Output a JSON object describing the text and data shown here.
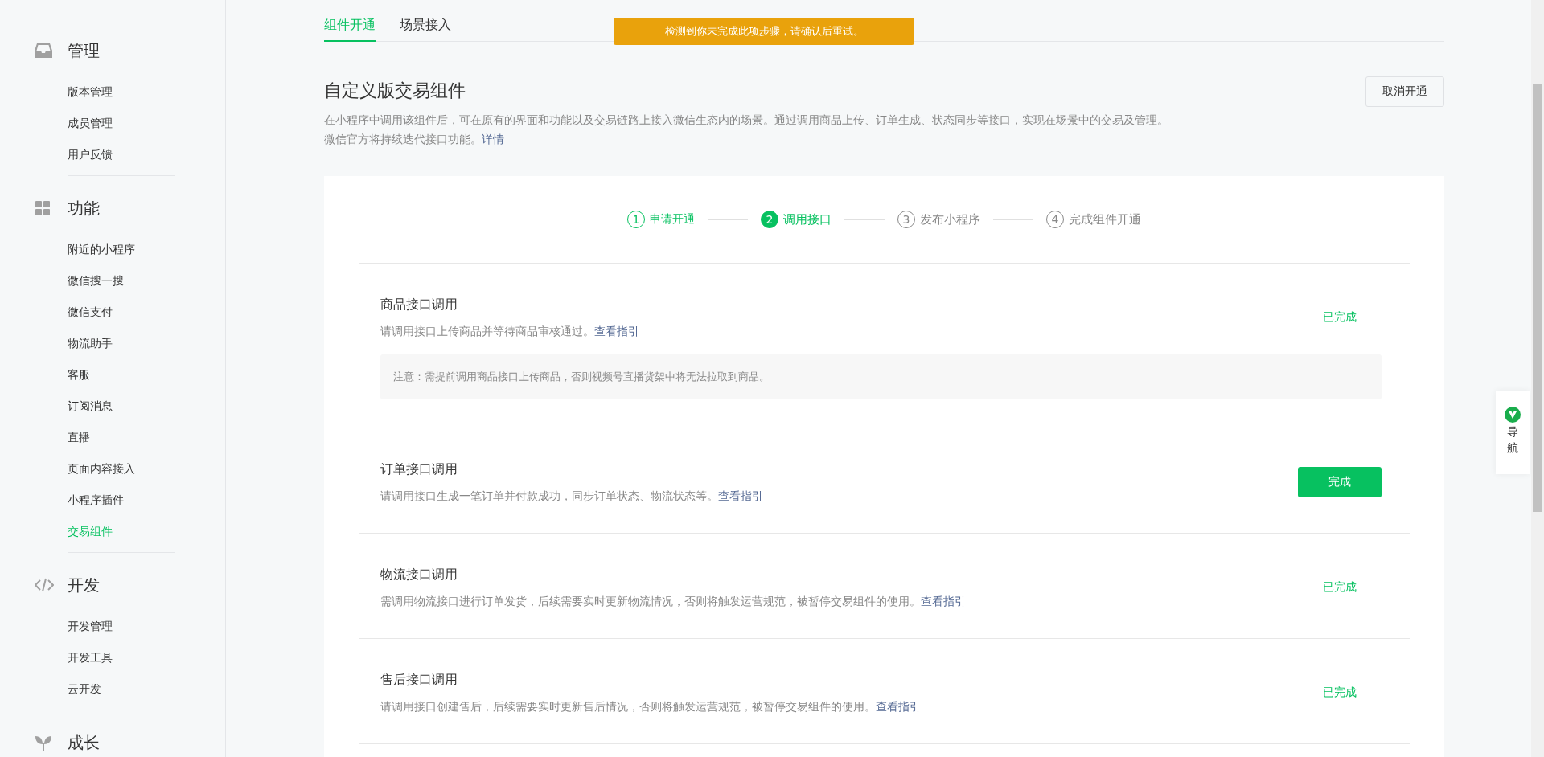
{
  "sidebar": {
    "groups": [
      {
        "title": "管理",
        "items": [
          {
            "label": "版本管理",
            "selected": false
          },
          {
            "label": "成员管理",
            "selected": false
          },
          {
            "label": "用户反馈",
            "selected": false
          }
        ]
      },
      {
        "title": "功能",
        "items": [
          {
            "label": "附近的小程序",
            "selected": false
          },
          {
            "label": "微信搜一搜",
            "selected": false
          },
          {
            "label": "微信支付",
            "selected": false
          },
          {
            "label": "物流助手",
            "selected": false
          },
          {
            "label": "客服",
            "selected": false
          },
          {
            "label": "订阅消息",
            "selected": false
          },
          {
            "label": "直播",
            "selected": false
          },
          {
            "label": "页面内容接入",
            "selected": false
          },
          {
            "label": "小程序插件",
            "selected": false
          },
          {
            "label": "交易组件",
            "selected": true
          }
        ]
      },
      {
        "title": "开发",
        "items": [
          {
            "label": "开发管理",
            "selected": false
          },
          {
            "label": "开发工具",
            "selected": false
          },
          {
            "label": "云开发",
            "selected": false
          }
        ]
      },
      {
        "title": "成长"
      }
    ]
  },
  "tabs": [
    {
      "label": "组件开通",
      "selected": true
    },
    {
      "label": "场景接入",
      "selected": false
    }
  ],
  "toast": {
    "text": "检测到你未完成此项步骤，请确认后重试。"
  },
  "header": {
    "title": "自定义版交易组件",
    "description": "在小程序中调用该组件后，可在原有的界面和功能以及交易链路上接入微信生态内的场景。通过调用商品上传、订单生成、状态同步等接口，实现在场景中的交易及管理。微信官方将持续迭代接口功能。",
    "link": "详情",
    "button": "取消开通"
  },
  "steps": [
    {
      "number": "1",
      "label": "申请开通",
      "done": true,
      "current": false
    },
    {
      "number": "2",
      "label": "调用接口",
      "done": false,
      "current": true
    },
    {
      "number": "3",
      "label": "发布小程序",
      "done": false,
      "current": false
    },
    {
      "number": "4",
      "label": "完成组件开通",
      "done": false,
      "current": false
    }
  ],
  "tasks": [
    {
      "title": "商品接口调用",
      "description": "请调用接口上传商品并等待商品审核通过。",
      "link": "查看指引",
      "note": "注意：需提前调用商品接口上传商品，否则视频号直播货架中将无法拉取到商品。",
      "status": {
        "kind": "text",
        "text": "已完成"
      }
    },
    {
      "title": "订单接口调用",
      "description": "请调用接口生成一笔订单并付款成功，同步订单状态、物流状态等。",
      "link": "查看指引",
      "status": {
        "kind": "button",
        "text": "完成"
      }
    },
    {
      "title": "物流接口调用",
      "description": "需调用物流接口进行订单发货，后续需要实时更新物流情况，否则将触发运营规范，被暂停交易组件的使用。",
      "link": "查看指引",
      "status": {
        "kind": "text",
        "text": "已完成"
      }
    },
    {
      "title": "售后接口调用",
      "description": "请调用接口创建售后，后续需要实时更新售后情况，否则将触发运营规范，被暂停交易组件的使用。",
      "link": "查看指引",
      "status": {
        "kind": "text",
        "text": "已完成"
      }
    }
  ],
  "nav_widget": {
    "label": "导航"
  }
}
